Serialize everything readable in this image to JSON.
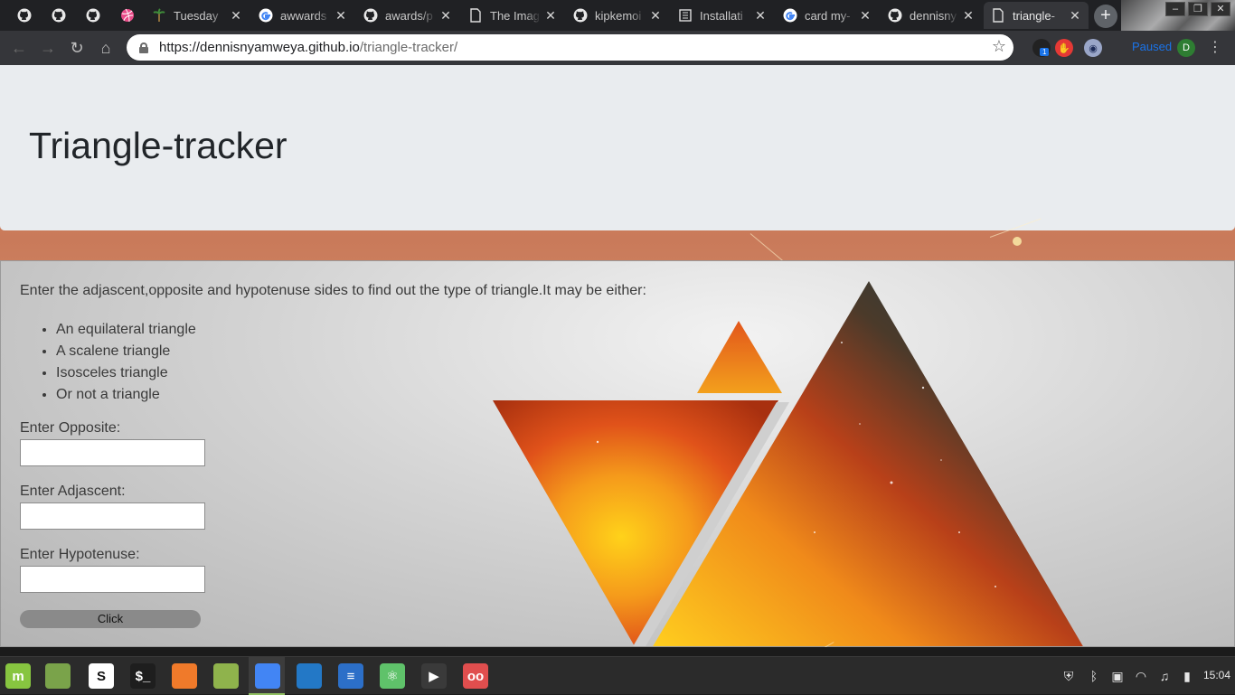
{
  "browser": {
    "tabs": [
      {
        "label": "",
        "icon": "github-icon",
        "pinned": true
      },
      {
        "label": "",
        "icon": "github-icon",
        "pinned": true
      },
      {
        "label": "",
        "icon": "github-icon",
        "pinned": true
      },
      {
        "label": "",
        "icon": "dribbble-icon",
        "pinned": true
      },
      {
        "label": "Tuesday",
        "icon": "palm-tree-icon"
      },
      {
        "label": "awwards",
        "icon": "google-icon"
      },
      {
        "label": "awards/p",
        "icon": "github-icon"
      },
      {
        "label": "The Imag",
        "icon": "page-icon"
      },
      {
        "label": "kipkemoi",
        "icon": "github-icon"
      },
      {
        "label": "Installati",
        "icon": "docs-icon"
      },
      {
        "label": "card my-",
        "icon": "google-icon"
      },
      {
        "label": "dennisny",
        "icon": "github-icon"
      },
      {
        "label": "triangle-",
        "icon": "page-icon",
        "active": true
      }
    ],
    "new_tab_symbol": "+",
    "window_controls": {
      "minimize": "‒",
      "restore": "❐",
      "close": "✕"
    },
    "nav": {
      "back": "←",
      "forward": "→",
      "reload": "↻",
      "home": "⌂"
    },
    "url_host": "https://dennisnyamweya.github.io",
    "url_path": "/triangle-tracker/",
    "bookmark_symbol": "☆",
    "extension_badge": "1",
    "profile_status": "Paused",
    "profile_initial": "D",
    "menu_symbol": "⋮"
  },
  "page": {
    "title": "Triangle-tracker",
    "intro": "Enter the adjascent,opposite and hypotenuse sides to find out the type of triangle.It may be either:",
    "types": [
      "An equilateral triangle",
      "A scalene triangle",
      "Isosceles triangle",
      "Or not a triangle"
    ],
    "fields": [
      {
        "label": "Enter Opposite:",
        "value": ""
      },
      {
        "label": "Enter Adjascent:",
        "value": ""
      },
      {
        "label": "Enter Hypotenuse:",
        "value": ""
      }
    ],
    "button_label": "Click"
  },
  "taskbar": {
    "apps": [
      {
        "name": "menu-icon",
        "color": "#87c540",
        "glyph": "m"
      },
      {
        "name": "files-icon",
        "color": "#7aa34a",
        "glyph": ""
      },
      {
        "name": "slack-icon",
        "color": "#ffffff",
        "glyph": "S"
      },
      {
        "name": "terminal-icon",
        "color": "#1e1e1e",
        "glyph": "$_"
      },
      {
        "name": "firefox-icon",
        "color": "#f07a2a",
        "glyph": ""
      },
      {
        "name": "folder-icon",
        "color": "#8fb34c",
        "glyph": ""
      },
      {
        "name": "chrome-icon",
        "color": "#4285f4",
        "glyph": ""
      },
      {
        "name": "vscode-icon",
        "color": "#2378c6",
        "glyph": ""
      },
      {
        "name": "text-editor-icon",
        "color": "#2c6fc8",
        "glyph": "≡"
      },
      {
        "name": "atom-icon",
        "color": "#5fc26a",
        "glyph": "⚛"
      },
      {
        "name": "media-player-icon",
        "color": "#3a3a3a",
        "glyph": "▶"
      },
      {
        "name": "glasses-app-icon",
        "color": "#e04e4e",
        "glyph": "oo"
      }
    ],
    "tray": [
      "shield-icon",
      "bluetooth-icon",
      "clipboard-icon",
      "wifi-icon",
      "music-icon",
      "battery-icon"
    ],
    "clock": "15:04"
  },
  "colors": {
    "accent_blue": "#1a73e8",
    "jumbotron_bg": "#e9ecef",
    "taskbar_accent": "#8fbf60"
  }
}
